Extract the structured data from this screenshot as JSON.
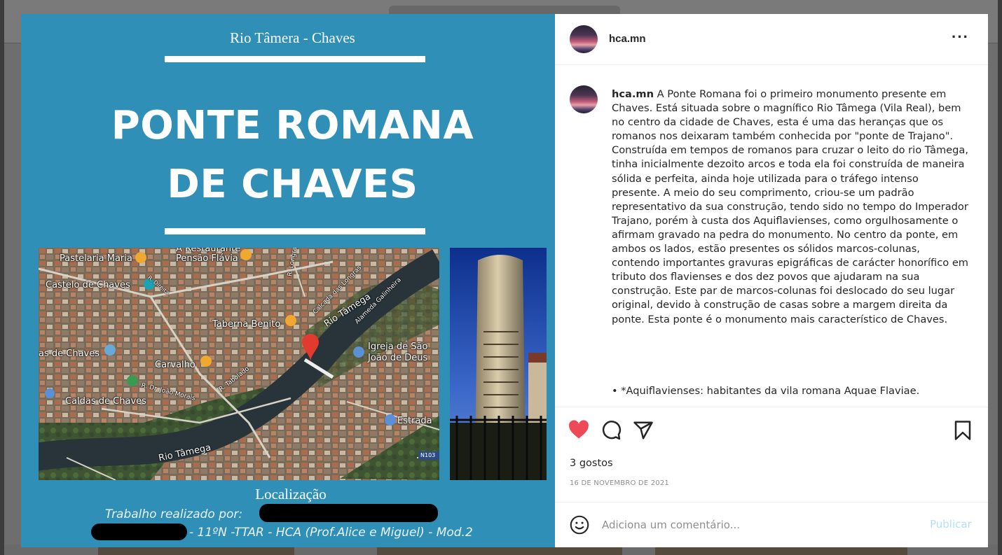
{
  "post": {
    "image": {
      "subtitle": "Rio Tâmera - Chaves",
      "title_line1": "PONTE ROMANA",
      "title_line2": "DE CHAVES",
      "map_labels": {
        "restaurant": "A Restaurante",
        "pastelaria": "Pastelaria Maria",
        "pensao": "Pensão Flávia",
        "castelo": "Castelo de Chaves",
        "taberna": "Taberna Benito",
        "rio_tamega_1": "Rio Tâmega",
        "rio_tamega_2": "Rio Tâmega",
        "igreja_1": "Igreja de São",
        "igreja_2": "João de Deus",
        "termas": "as de Chaves",
        "carvalho": "Carvalho",
        "rua_joao": "R. Dr. João Morais",
        "rua_tabolado": "R. Tabolado",
        "caldas": "Caldas de Chaves",
        "estrada": "Estrada",
        "rua_longras": "R. Longras",
        "calcada": "Calcada das Longras",
        "alameda": "Alameda Galinheira",
        "n103": "N103",
        "rua_direita": "R. Direita"
      },
      "caption": "Localização",
      "credit_line1": "Trabalho realizado por:",
      "credit_line2": "- 11ºN -TTAR - HCA (Prof.Alice e Miguel) - Mod.2"
    },
    "header": {
      "username": "hca.mn",
      "more": "···"
    },
    "caption": {
      "username": "hca.mn",
      "text": "A Ponte Romana foi o primeiro monumento presente em Chaves. Está situada sobre o magnífico Rio Tâmega (Vila Real), bem no centro da cidade de Chaves, esta é uma das heranças que os romanos nos deixaram também conhecida por \"ponte de Trajano\". Construída em tempos de romanos para cruzar o leito do rio Tâmega, tinha inicialmente dezoito arcos e toda ela foi construída de maneira sólida e perfeita, ainda hoje utilizada para o tráfego intenso presente. A meio do seu comprimento, criou-se um padrão representativo da sua construção, tendo sido no tempo do Imperador Trajano, porém à custa dos Aquiflavienses, como orgulhosamente o afirmam gravado na pedra do monumento. No centro da ponte, em ambos os lados, estão presentes os sólidos marcos-colunas, contendo importantes gravuras epigráficas de carácter honorífico em tributo dos flavienses e dos dez povos que ajudaram na sua construção. Este par de marcos-colunas foi deslocado do seu lugar original, devido à construção de casas sobre a margem direita da ponte. Esta ponte é o monumento mais característico de Chaves.",
      "footnote": "• *Aquiflavienses: habitantes da vila romana Aquae Flaviae."
    },
    "likes": "3 gostos",
    "date": "16 DE NOVEMBRO DE 2021",
    "comment_placeholder": "Adiciona um comentário...",
    "publish_label": "Publicar",
    "icons": {
      "like": "heart-filled-icon",
      "comment": "comment-icon",
      "share": "paper-plane-icon",
      "save": "bookmark-icon",
      "emoji": "smiley-icon"
    },
    "colors": {
      "poster_bg": "#2f8fb6",
      "like_red": "#ed4956",
      "publish_blue": "#b2dffc"
    }
  }
}
